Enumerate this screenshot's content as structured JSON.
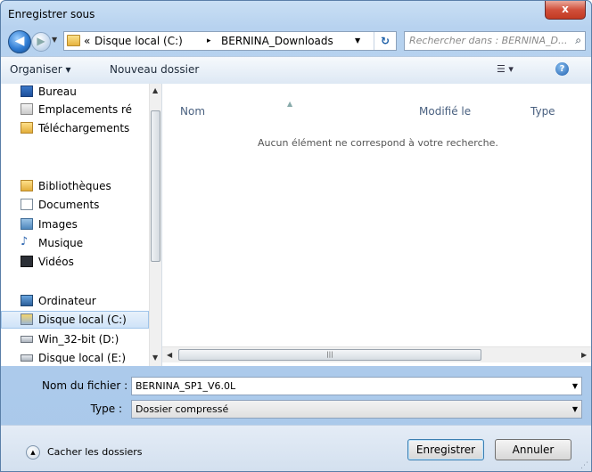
{
  "window": {
    "title": "Enregistrer sous",
    "close_label": "x"
  },
  "navbar": {
    "back_glyph": "◀",
    "forward_glyph": "▶",
    "path_prefix": "«",
    "crumbs": [
      "Disque local (C:)",
      "BERNINA_Downloads"
    ],
    "separator": "▸",
    "search_placeholder": "Rechercher dans : BERNINA_D..."
  },
  "toolbar": {
    "organize_label": "Organiser ▾",
    "new_folder_label": "Nouveau dossier"
  },
  "sidebar": {
    "items": [
      {
        "label": "Bureau",
        "icon": "desktop-icon"
      },
      {
        "label": "Emplacements ré",
        "icon": "recent-places-icon"
      },
      {
        "label": "Téléchargements",
        "icon": "downloads-icon"
      },
      {
        "label": "Bibliothèques",
        "icon": "libraries-icon"
      },
      {
        "label": "Documents",
        "icon": "documents-icon"
      },
      {
        "label": "Images",
        "icon": "images-icon"
      },
      {
        "label": "Musique",
        "icon": "music-icon"
      },
      {
        "label": "Vidéos",
        "icon": "videos-icon"
      },
      {
        "label": "Ordinateur",
        "icon": "computer-icon"
      },
      {
        "label": "Disque local (C:)",
        "icon": "drive-c-icon",
        "selected": true
      },
      {
        "label": "Win_32-bit (D:)",
        "icon": "drive-d-icon"
      },
      {
        "label": "Disque local (E:)",
        "icon": "drive-e-icon"
      }
    ]
  },
  "file_list": {
    "columns": [
      "Nom",
      "Modifié le",
      "Type"
    ],
    "empty_message": "Aucun élément ne correspond à votre recherche."
  },
  "form": {
    "filename_label": "Nom du fichier :",
    "filename_value": "BERNINA_SP1_V6.0L",
    "type_label": "Type :",
    "type_value": "Dossier compressé"
  },
  "footer": {
    "hide_folders_label": "Cacher les dossiers",
    "save_label": "Enregistrer",
    "cancel_label": "Annuler"
  }
}
